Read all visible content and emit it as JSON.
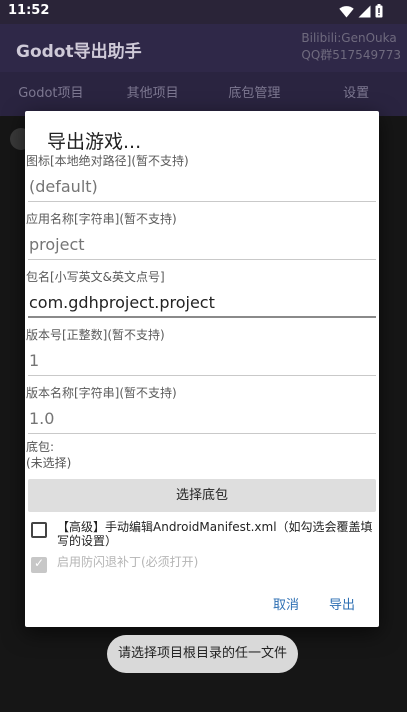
{
  "status_bar": {
    "time": "11:52"
  },
  "app_bar": {
    "title": "Godot导出助手",
    "credit_line1": "Bilibili:GenOuka",
    "credit_line2": "QQ群517549773"
  },
  "tabs": [
    {
      "label": "Godot项目"
    },
    {
      "label": "其他项目"
    },
    {
      "label": "底包管理"
    },
    {
      "label": "设置"
    }
  ],
  "dialog": {
    "title": "导出游戏...",
    "fields": [
      {
        "label": "图标[本地绝对路径](暂不支持)",
        "placeholder": "(default)",
        "value": ""
      },
      {
        "label": "应用名称[字符串](暂不支持)",
        "placeholder": "project",
        "value": ""
      },
      {
        "label": "包名[小写英文&英文点号]",
        "placeholder": "",
        "value": "com.gdhproject.project"
      },
      {
        "label": "版本号[正整数](暂不支持)",
        "placeholder": "1",
        "value": ""
      },
      {
        "label": "版本名称[字符串](暂不支持)",
        "placeholder": "1.0",
        "value": ""
      }
    ],
    "base_package": {
      "label": "底包:",
      "value": "(未选择)"
    },
    "select_button": "选择底包",
    "checkbox_manifest": {
      "label": "【高级】手动编辑AndroidManifest.xml（如勾选会覆盖填写的设置）",
      "checked": false
    },
    "checkbox_patch": {
      "label": "启用防闪退补丁(必须打开)",
      "checked": true,
      "disabled": true
    },
    "cancel": "取消",
    "export": "导出"
  },
  "toast": "请选择项目根目录的任一文件"
}
